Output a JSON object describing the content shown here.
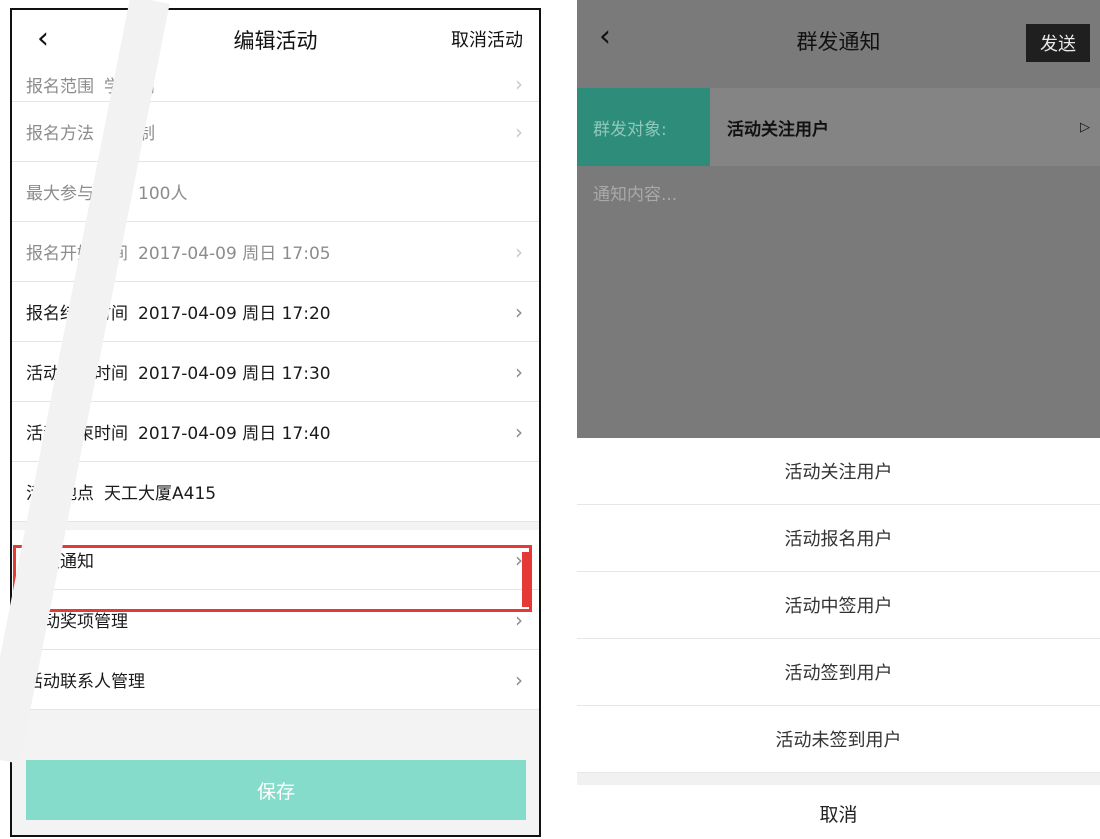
{
  "left": {
    "title": "编辑活动",
    "cancel_label": "取消活动",
    "rows": [
      {
        "label": "报名范围",
        "value": "学校内"
      },
      {
        "label": "报名方法",
        "value": "评审制"
      },
      {
        "label": "最大参与人数",
        "value": "100人"
      },
      {
        "label": "报名开始时间",
        "value": "2017-04-09 周日 17:05"
      },
      {
        "label": "报名结束时间",
        "value": "2017-04-09 周日 17:20"
      },
      {
        "label": "活动开始时间",
        "value": "2017-04-09 周日 17:30"
      },
      {
        "label": "活动结束时间",
        "value": "2017-04-09 周日 17:40"
      },
      {
        "label": "活动地点",
        "value": "天工大厦A415"
      }
    ],
    "menu": [
      {
        "label": "群发通知"
      },
      {
        "label": "活动奖项管理"
      },
      {
        "label": "活动联系人管理"
      }
    ],
    "save_label": "保存",
    "highlight_color": "#e53935",
    "save_color": "#86dccb"
  },
  "right": {
    "title": "群发通知",
    "send_label": "发送",
    "target_label": "群发对象:",
    "target_value": "活动关注用户",
    "content_placeholder": "通知内容...",
    "options": [
      "活动关注用户",
      "活动报名用户",
      "活动中签用户",
      "活动签到用户",
      "活动未签到用户"
    ],
    "cancel_label": "取消",
    "accent_color": "#2e8c7a"
  },
  "icons": {
    "back": "chevron-left-icon",
    "row_arrow": "chevron-right-icon",
    "dropdown_arrow": "triangle-right-icon"
  }
}
